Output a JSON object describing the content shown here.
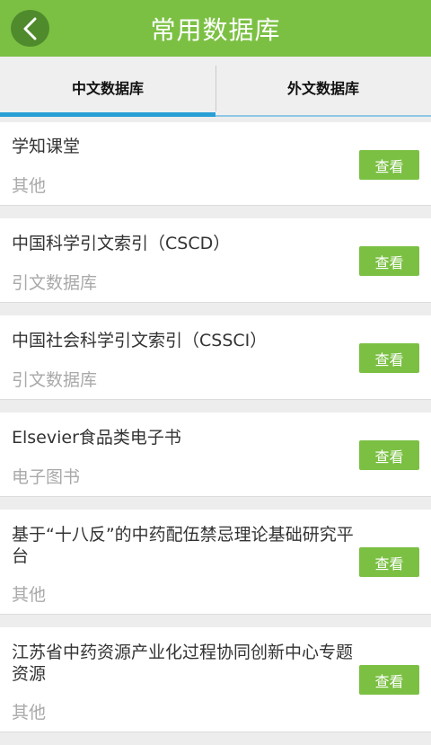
{
  "header": {
    "title": "常用数据库"
  },
  "tabs": [
    {
      "label": "中文数据库",
      "active": true
    },
    {
      "label": "外文数据库",
      "active": false
    }
  ],
  "view_label": "查看",
  "colors": {
    "brand_green": "#7bc043",
    "tab_accent": "#2a9fd6"
  },
  "items": [
    {
      "title": "学知课堂",
      "category": "其他"
    },
    {
      "title": "中国科学引文索引（CSCD）",
      "category": "引文数据库"
    },
    {
      "title": "中国社会科学引文索引（CSSCI）",
      "category": "引文数据库"
    },
    {
      "title": "Elsevier食品类电子书",
      "category": "电子图书"
    },
    {
      "title": "基于“十八反”的中药配伍禁忌理论基础研究平台",
      "category": "其他"
    },
    {
      "title": "江苏省中药资源产业化过程协同创新中心专题资源",
      "category": "其他"
    }
  ]
}
